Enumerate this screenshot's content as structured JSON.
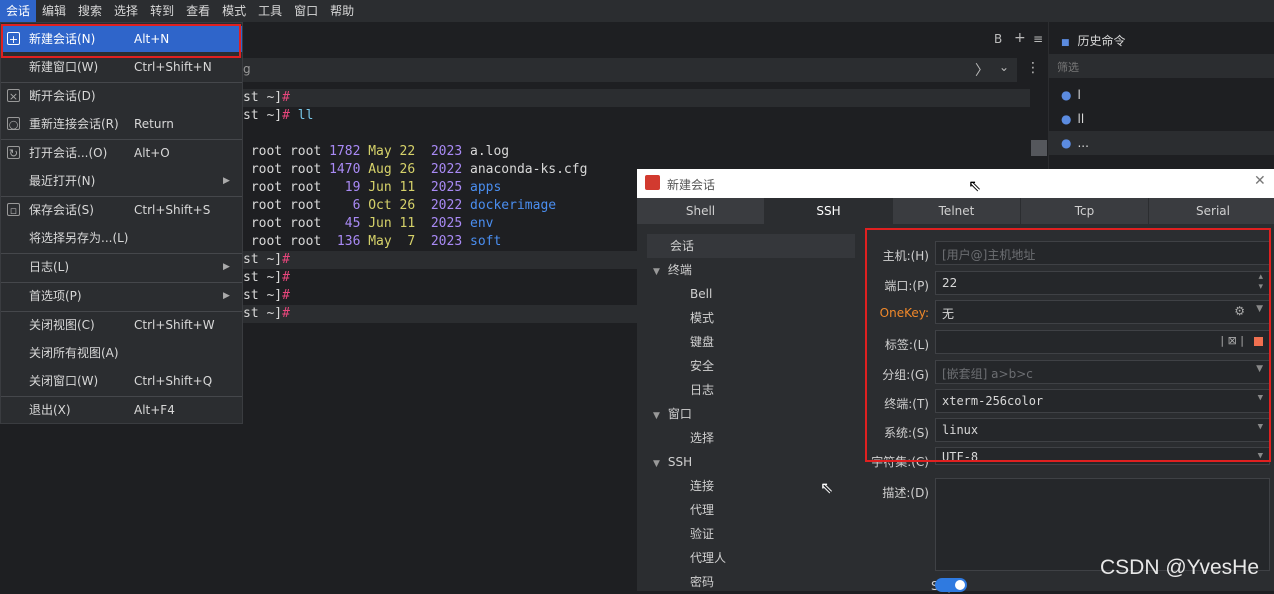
{
  "menubar": {
    "items": [
      "会话",
      "编辑",
      "搜索",
      "选择",
      "转到",
      "查看",
      "模式",
      "工具",
      "窗口",
      "帮助"
    ]
  },
  "tabbar": {
    "b_label": "B",
    "plus": "+",
    "menu": "≡"
  },
  "address": {
    "text": "g",
    "chev": "〉",
    "chev_down": "⌄",
    "kebab": "⋮"
  },
  "terminal": {
    "lines": [
      {
        "pre": "st ~]",
        "hash": "#",
        "cmd": ""
      },
      {
        "pre": "st ~]",
        "hash": "#",
        "cmd": " ll"
      },
      {
        "pre": "",
        "hash": "",
        "cmd": ""
      },
      {
        "owner": " root root ",
        "size": "1782",
        "mon": "May",
        "day": "22",
        "yr": "2023",
        "name": "a.log",
        "type": "file"
      },
      {
        "owner": " root root ",
        "size": "1470",
        "mon": "Aug",
        "day": "26",
        "yr": "2022",
        "name": "anaconda-ks.cfg",
        "type": "file"
      },
      {
        "owner": " root root ",
        "size": "  19",
        "mon": "Jun",
        "day": "11",
        "yr": "2025",
        "name": "apps",
        "type": "dir"
      },
      {
        "owner": " root root ",
        "size": "   6",
        "mon": "Oct",
        "day": "26",
        "yr": "2022",
        "name": "dockerimage",
        "type": "dir"
      },
      {
        "owner": " root root ",
        "size": "  45",
        "mon": "Jun",
        "day": "11",
        "yr": "2025",
        "name": "env",
        "type": "dir"
      },
      {
        "owner": " root root ",
        "size": " 136",
        "mon": "May",
        "day": " 7",
        "yr": "2023",
        "name": "soft",
        "type": "dir"
      },
      {
        "pre": "st ~]",
        "hash": "#",
        "cmd": ""
      },
      {
        "pre": "st ~]",
        "hash": "#",
        "cmd": ""
      },
      {
        "pre": "st ~]",
        "hash": "#",
        "cmd": ""
      },
      {
        "pre": "st ~]",
        "hash": "#",
        "cmd": ""
      }
    ]
  },
  "history": {
    "title": "历史命令",
    "filter_placeholder": "筛选",
    "items": [
      "l",
      "ll",
      "..."
    ]
  },
  "session_menu": {
    "items": [
      {
        "label": "新建会话(N)",
        "shortcut": "Alt+N",
        "icon": "new-session-icon"
      },
      {
        "label": "新建窗口(W)",
        "shortcut": "Ctrl+Shift+N"
      },
      {
        "label": "断开会话(D)",
        "shortcut": "",
        "icon": "disconnect-icon"
      },
      {
        "label": "重新连接会话(R)",
        "shortcut": "Return",
        "icon": "reconnect-icon"
      },
      {
        "label": "打开会话...(O)",
        "shortcut": "Alt+O",
        "icon": "open-session-icon"
      },
      {
        "label": "最近打开(N)",
        "shortcut": "",
        "submenu": true
      },
      {
        "label": "保存会话(S)",
        "shortcut": "Ctrl+Shift+S",
        "icon": "save-icon"
      },
      {
        "label": "将选择另存为...(L)",
        "shortcut": ""
      },
      {
        "label": "日志(L)",
        "shortcut": "",
        "submenu": true
      },
      {
        "label": "首选项(P)",
        "shortcut": "",
        "submenu": true
      },
      {
        "label": "关闭视图(C)",
        "shortcut": "Ctrl+Shift+W"
      },
      {
        "label": "关闭所有视图(A)",
        "shortcut": ""
      },
      {
        "label": "关闭窗口(W)",
        "shortcut": "Ctrl+Shift+Q"
      },
      {
        "label": "退出(X)",
        "shortcut": "Alt+F4"
      }
    ]
  },
  "dialog": {
    "title": "新建会话",
    "close": "✕",
    "tabs": [
      "Shell",
      "SSH",
      "Telnet",
      "Tcp",
      "Serial"
    ],
    "selected_tab": "SSH",
    "tree": [
      {
        "label": "会话",
        "level": 0,
        "expandable": false
      },
      {
        "label": "终端",
        "level": 0,
        "expandable": true
      },
      {
        "label": "Bell",
        "level": 1
      },
      {
        "label": "模式",
        "level": 1
      },
      {
        "label": "键盘",
        "level": 1
      },
      {
        "label": "安全",
        "level": 1
      },
      {
        "label": "日志",
        "level": 1
      },
      {
        "label": "窗口",
        "level": 0,
        "expandable": true
      },
      {
        "label": "选择",
        "level": 1
      },
      {
        "label": "SSH",
        "level": 0,
        "expandable": true
      },
      {
        "label": "连接",
        "level": 1
      },
      {
        "label": "代理",
        "level": 1
      },
      {
        "label": "验证",
        "level": 1
      },
      {
        "label": "代理人",
        "level": 1
      },
      {
        "label": "密码",
        "level": 1
      }
    ],
    "fields": {
      "host_label": "主机:(H)",
      "host_placeholder": "[用户@]主机地址",
      "port_label": "端口:(P)",
      "port_value": "22",
      "onekey_label": "OneKey:",
      "onekey_value": "无",
      "tag_label": "标签:(L)",
      "tag_value": "",
      "group_label": "分组:(G)",
      "group_placeholder": "[嵌套组] a>b>c",
      "terminal_label": "终端:(T)",
      "terminal_value": "xterm-256color",
      "system_label": "系统:(S)",
      "system_value": "linux",
      "charset_label": "字符集:(C)",
      "charset_value": "UTF-8",
      "desc_label": "描述:(D)",
      "sftp_label": "Sftp:"
    }
  },
  "watermark": "CSDN @YvesHe",
  "colors": {
    "accent": "#2f65ca",
    "highlight_box": "#e02020",
    "toggle": "#2f7ae0"
  }
}
